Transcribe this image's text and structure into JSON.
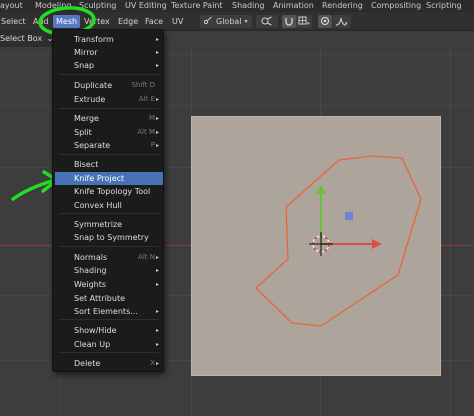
{
  "workspace_tabs": [
    "ayout",
    "Modeling",
    "Sculpting",
    "UV Editing",
    "Texture Paint",
    "Shading",
    "Animation",
    "Rendering",
    "Compositing",
    "Scripting"
  ],
  "header": {
    "menus": [
      "Select",
      "Add",
      "Mesh",
      "Vertex",
      "Edge",
      "Face",
      "UV"
    ],
    "orientation_label": "Global",
    "orientation_icon": "transform-orientation-icon",
    "pivot_icon": "pivot-point-icon",
    "snap_icon": "snap-magnet-icon",
    "proportional_icon": "proportional-editing-icon",
    "falloff_icon": "falloff-curve-icon"
  },
  "tool_header": {
    "select_box_label": "Select Box",
    "select_box_arrow": "⌄"
  },
  "mesh_menu": {
    "items": [
      {
        "label": "Transform",
        "shortcut": "",
        "submenu": true
      },
      {
        "label": "Mirror",
        "shortcut": "",
        "submenu": true
      },
      {
        "label": "Snap",
        "shortcut": "",
        "submenu": true
      },
      {
        "label": "Duplicate",
        "shortcut": "Shift D",
        "submenu": false
      },
      {
        "label": "Extrude",
        "shortcut": "Alt E",
        "submenu": true
      },
      {
        "label": "Merge",
        "shortcut": "M",
        "submenu": true
      },
      {
        "label": "Split",
        "shortcut": "Alt M",
        "submenu": true
      },
      {
        "label": "Separate",
        "shortcut": "P",
        "submenu": true
      },
      {
        "label": "Bisect",
        "shortcut": "",
        "submenu": false
      },
      {
        "label": "Knife Project",
        "shortcut": "",
        "submenu": false
      },
      {
        "label": "Knife Topology Tool",
        "shortcut": "",
        "submenu": false
      },
      {
        "label": "Convex Hull",
        "shortcut": "",
        "submenu": false
      },
      {
        "label": "Symmetrize",
        "shortcut": "",
        "submenu": false
      },
      {
        "label": "Snap to Symmetry",
        "shortcut": "",
        "submenu": false
      },
      {
        "label": "Normals",
        "shortcut": "Alt N",
        "submenu": true
      },
      {
        "label": "Shading",
        "shortcut": "",
        "submenu": true
      },
      {
        "label": "Weights",
        "shortcut": "",
        "submenu": true
      },
      {
        "label": "Set Attribute",
        "shortcut": "",
        "submenu": false
      },
      {
        "label": "Sort Elements...",
        "shortcut": "",
        "submenu": true
      },
      {
        "label": "Show/Hide",
        "shortcut": "",
        "submenu": true
      },
      {
        "label": "Clean Up",
        "shortcut": "",
        "submenu": true
      },
      {
        "label": "Delete",
        "shortcut": "X",
        "submenu": true
      }
    ],
    "highlighted": "Knife Project"
  },
  "icons": {
    "submenu_arrow": "▸",
    "annotation_arrow": "green-annotation-arrow-icon",
    "annotation_circle": "green-annotation-circle-icon",
    "gizmo": "transform-gizmo-icon"
  },
  "colors": {
    "highlight": "#4772b3",
    "annotation_green": "#22dd22",
    "curve_orange": "#e8643a",
    "plane": "#ada49c",
    "axis_x": "#d8504a",
    "axis_y": "#6cbf3f"
  }
}
